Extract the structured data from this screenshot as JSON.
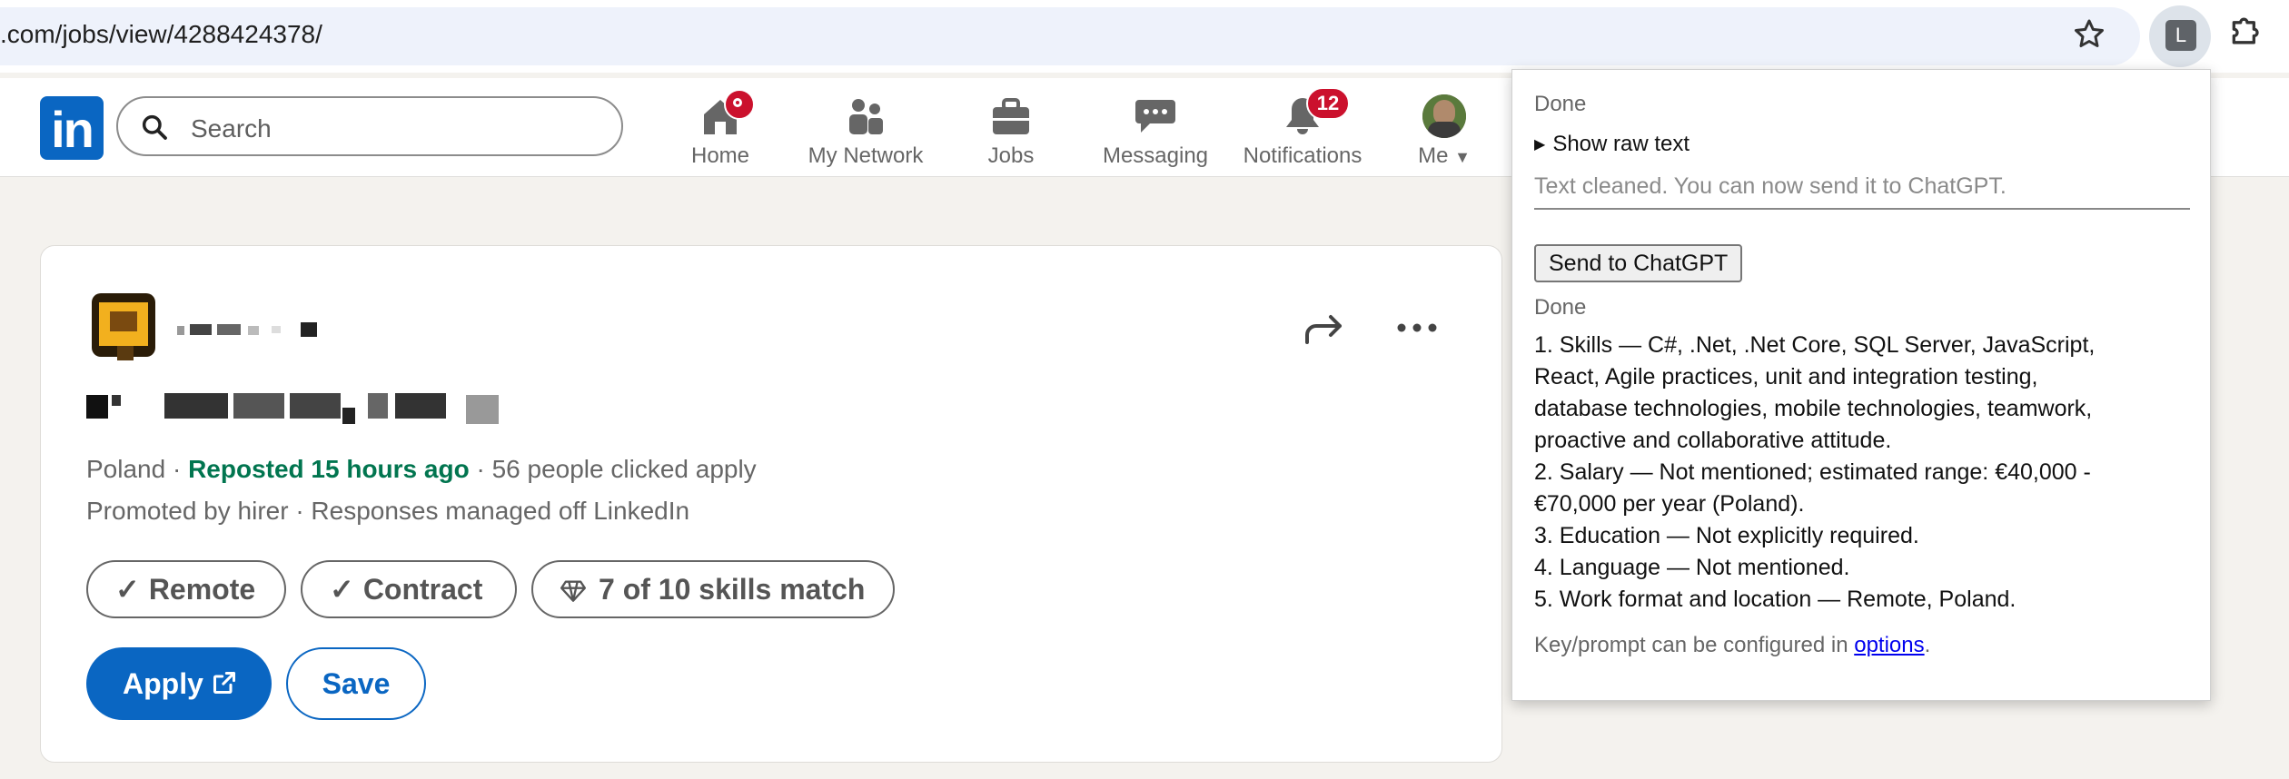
{
  "browser": {
    "url": ".com/jobs/view/4288424378/",
    "extension_badge": "L"
  },
  "linkedin_nav": {
    "logo": "in",
    "search_placeholder": "Search",
    "items": [
      {
        "label": "Home",
        "icon": "home-icon"
      },
      {
        "label": "My Network",
        "icon": "people-icon"
      },
      {
        "label": "Jobs",
        "icon": "briefcase-icon"
      },
      {
        "label": "Messaging",
        "icon": "chat-icon"
      },
      {
        "label": "Notifications",
        "icon": "bell-icon",
        "badge": "12"
      },
      {
        "label": "Me",
        "icon": "avatar"
      }
    ]
  },
  "job": {
    "location": "Poland",
    "sep1": " · ",
    "reposted": "Reposted 15 hours ago",
    "sep2": " · ",
    "applicants": "56 people clicked apply",
    "promoted": "Promoted by hirer · Responses managed off LinkedIn",
    "tags": [
      {
        "label": "Remote",
        "icon": "check-icon"
      },
      {
        "label": "Contract",
        "icon": "check-icon"
      },
      {
        "label": "7 of 10 skills match",
        "icon": "diamond-icon"
      }
    ],
    "apply_label": "Apply",
    "save_label": "Save"
  },
  "popup": {
    "status_top": "Done",
    "raw_toggle": "Show raw text",
    "textarea_text": "Text cleaned. You can now send it to ChatGPT.",
    "send_button": "Send to ChatGPT",
    "status_bottom": "Done",
    "results": [
      "1. Skills — C#, .Net, .Net Core, SQL Server, JavaScript,\nReact, Agile practices, unit and integration testing,\ndatabase technologies, mobile technologies, teamwork,\nproactive and collaborative attitude.",
      "2. Salary — Not mentioned; estimated range: €40,000 -\n€70,000 per year (Poland).",
      "3. Education — Not explicitly required.",
      "4. Language — Not mentioned.",
      "5. Work format and location — Remote, Poland."
    ],
    "footer_prefix": "Key/prompt can be configured in ",
    "footer_link": "options",
    "footer_suffix": "."
  },
  "colors": {
    "linkedin_blue": "#0a66c2",
    "badge_red": "#cb112d",
    "reposted_green": "#01754f"
  }
}
